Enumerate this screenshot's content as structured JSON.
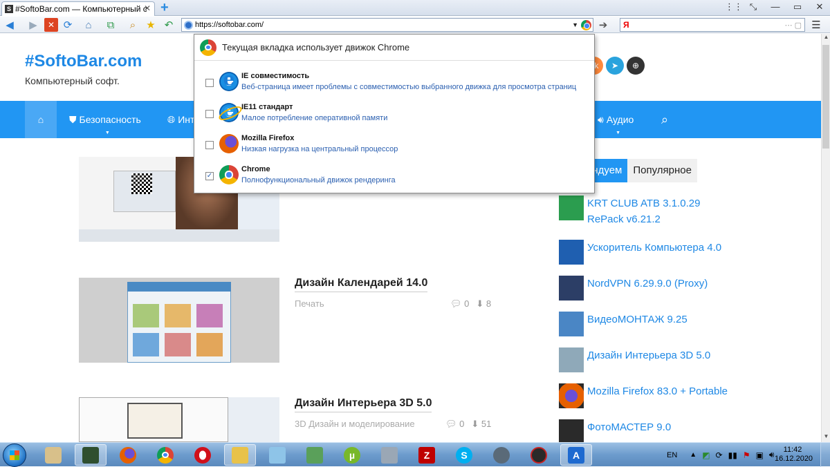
{
  "browser": {
    "tab_title": "#SoftoBar.com — Компьютерный со...",
    "tab_favicon": "S",
    "new_tab": "+",
    "address": "https://softobar.com/",
    "search_engine": "Я"
  },
  "dropdown": {
    "header": "Текущая вкладка использует движок Chrome",
    "engines": [
      {
        "name": "IE совместимость",
        "desc": "Веб-страница имеет проблемы с совместимостью выбранного движка для просмотра страниц",
        "checked": false,
        "icon": "ie-icon"
      },
      {
        "name": "IE11 стандарт",
        "desc": "Малое потребление оперативной памяти",
        "checked": false,
        "icon": "ie11-icon"
      },
      {
        "name": "Mozilla Firefox",
        "desc": "Низкая нагрузка на центральный процессор",
        "checked": false,
        "icon": "firefox-icon"
      },
      {
        "name": "Chrome",
        "desc": "Полнофункциональный движок рендеринга",
        "checked": true,
        "icon": "chrome-icon"
      }
    ],
    "check_mark": "✓"
  },
  "site": {
    "title": "#SoftoBar.com",
    "subtitle": "Компьютерный софт.",
    "nav": {
      "security": "Безопасность",
      "internet_partial": "Инт",
      "audio": "Аудио"
    }
  },
  "posts": [
    {
      "title": "Дизайн Календарей 14.0",
      "category": "Печать",
      "comments": "0",
      "downloads": "8"
    },
    {
      "title": "Дизайн Интерьера 3D 5.0",
      "category": "3D Дизайн и моделирование",
      "comments": "0",
      "downloads": "51"
    }
  ],
  "sidebar": {
    "tab_active": "ендуем",
    "tab_popular": "Популярное",
    "items": [
      {
        "label": "KRT CLUB ATB 3.1.0.29 RePack v6.21.2",
        "color": "#2b9d4f"
      },
      {
        "label": "Ускоритель Компьютера 4.0",
        "color": "#1f5fb0"
      },
      {
        "label": "NordVPN 6.29.9.0 (Proxy)",
        "color": "#2c3e66"
      },
      {
        "label": "ВидеоМОНТАЖ 9.25",
        "color": "#4a86c5"
      },
      {
        "label": "Дизайн Интерьера 3D 5.0",
        "color": "#8fa9b9"
      },
      {
        "label": "Mozilla Firefox 83.0 + Portable",
        "color": "#e66000"
      },
      {
        "label": "ФотоМАСТЕР 9.0",
        "color": "#2a2a2a"
      }
    ]
  },
  "taskbar": {
    "lang": "EN",
    "time": "11:42",
    "date": "16.12.2020"
  }
}
